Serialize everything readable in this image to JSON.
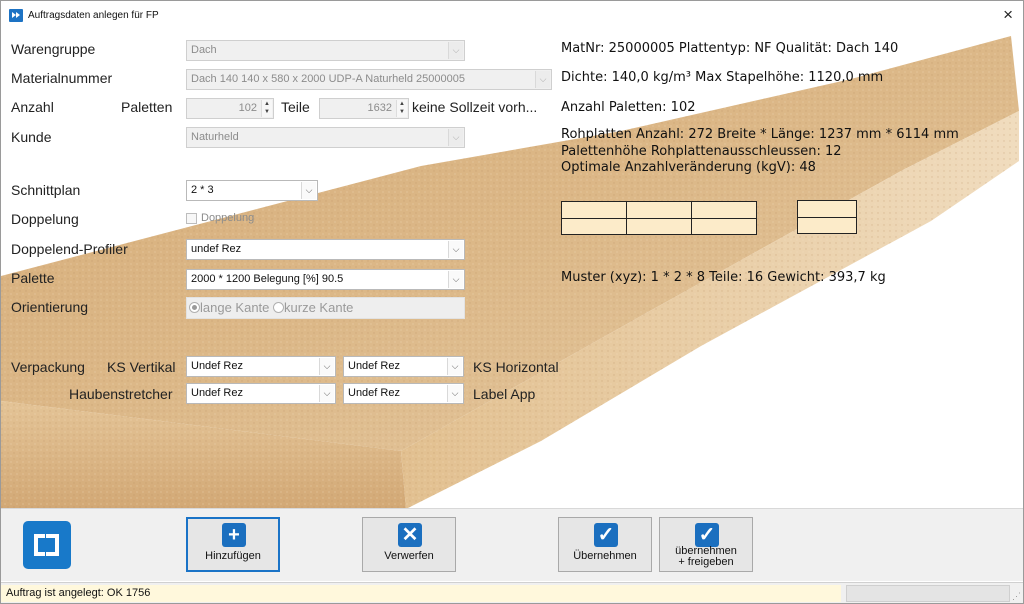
{
  "window": {
    "title": "Auftragsdaten anlegen für FP",
    "close_icon": "×"
  },
  "form": {
    "warengruppe": {
      "label": "Warengruppe",
      "value": "Dach"
    },
    "materialnummer": {
      "label": "Materialnummer",
      "value": "Dach 140 140 x 580 x 2000 UDP-A Naturheld 25000005"
    },
    "anzahl": {
      "label": "Anzahl",
      "paletten_label": "Paletten",
      "paletten_value": "102",
      "teile_label": "Teile",
      "teile_value": "1632",
      "sollzeit_text": "keine  Sollzeit vorh..."
    },
    "kunde": {
      "label": "Kunde",
      "value": "Naturheld"
    },
    "schnittplan": {
      "label": "Schnittplan",
      "value": "2 * 3"
    },
    "doppelung": {
      "label": "Doppelung",
      "checkbox_label": "Doppelung"
    },
    "doppelend_profiler": {
      "label": "Doppelend-Profiler",
      "value": "undef Rez"
    },
    "palette": {
      "label": "Palette",
      "value": "2000 * 1200 Belegung [%] 90.5"
    },
    "orientierung": {
      "label": "Orientierung",
      "option1": "lange Kante",
      "option2": "kurze Kante"
    },
    "verpackung": {
      "label": "Verpackung",
      "ks_vertikal_label": "KS Vertikal",
      "ks_vertikal_value": "Undef Rez",
      "ks_horizontal_value": "Undef Rez",
      "ks_horizontal_label": "KS Horizontal",
      "haubenstretcher_label": "Haubenstretcher",
      "haubenstretcher_value": "Undef Rez",
      "label_app_value": "Undef Rez",
      "label_app_label": "Label App"
    }
  },
  "info": {
    "line1": "MatNr: 25000005 Plattentyp: NF Qualität: Dach 140",
    "line2": "Dichte: 140,0 kg/m³   Max Stapelhöhe: 1120,0 mm",
    "line3": "Anzahl Paletten: 102",
    "line4": "Rohplatten Anzahl: 272 Breite * Länge: 1237 mm * 6114 mm",
    "line5": "Palettenhöhe Rohplattenausschleussen: 12",
    "line6": "Optimale Anzahlveränderung (kgV): 48",
    "line7": "Muster (xyz): 1 * 2 * 8 Teile: 16 Gewicht: 393,7 kg"
  },
  "toolbar": {
    "add": {
      "label": "Hinzufügen",
      "icon": "plus-icon"
    },
    "discard": {
      "label": "Verwerfen",
      "icon": "x-icon"
    },
    "accept": {
      "label": "Übernehmen",
      "icon": "check-icon"
    },
    "accept_release_line1": "übernehmen",
    "accept_release_line2": "+ freigeben"
  },
  "status": {
    "text": "Auftrag ist angelegt: OK 1756"
  },
  "colors": {
    "accent": "#1b6fbf",
    "board": "#d9b382",
    "grid_fill": "#fcebc9"
  }
}
